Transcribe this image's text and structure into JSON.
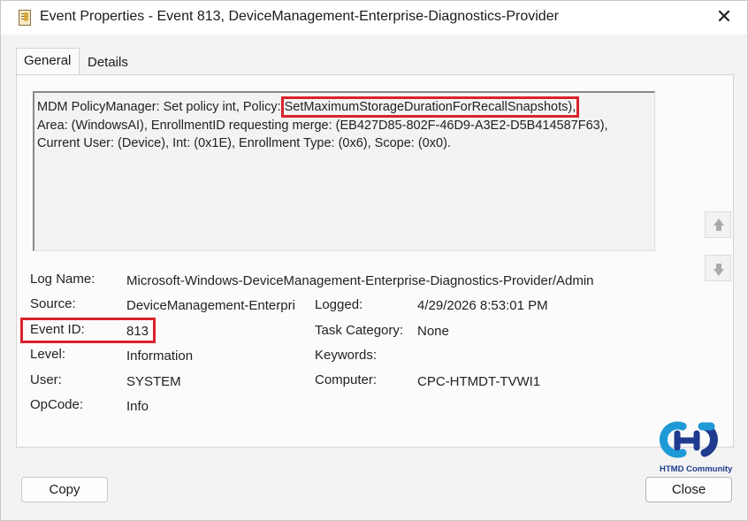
{
  "window": {
    "title": "Event Properties - Event 813, DeviceManagement-Enterprise-Diagnostics-Provider",
    "close_glyph": "✕"
  },
  "tabs": [
    {
      "label": "General",
      "active": true
    },
    {
      "label": "Details",
      "active": false
    }
  ],
  "description": {
    "prefix": "MDM PolicyManager: Set policy int, Policy: ",
    "policy": "SetMaximumStorageDurationForRecallSnapshots),",
    "line2": "Area: (WindowsAI), EnrollmentID requesting merge: (EB427D85-802F-46D9-A3E2-D5B414587F63),",
    "line3": "Current User: (Device), Int: (0x1E), Enrollment Type: (0x6), Scope: (0x0)."
  },
  "fields": {
    "log_name_label": "Log Name:",
    "log_name": "Microsoft-Windows-DeviceManagement-Enterprise-Diagnostics-Provider/Admin",
    "source_label": "Source:",
    "source": "DeviceManagement-Enterpri",
    "logged_label": "Logged:",
    "logged": "4/29/2026 8:53:01 PM",
    "event_id_label": "Event ID:",
    "event_id": "813",
    "task_category_label": "Task Category:",
    "task_category": "None",
    "level_label": "Level:",
    "level": "Information",
    "keywords_label": "Keywords:",
    "keywords": "",
    "user_label": "User:",
    "user": "SYSTEM",
    "computer_label": "Computer:",
    "computer": "CPC-HTMDT-TVWI1",
    "opcode_label": "OpCode:",
    "opcode": "Info"
  },
  "buttons": {
    "copy": "Copy",
    "close": "Close"
  },
  "watermark": {
    "text": "HTMD Community"
  },
  "colors": {
    "highlight": "#d9232e",
    "logo_blue": "#1f3b8e",
    "logo_light": "#1e9ad6"
  },
  "icons": {
    "app": "event-log-icon",
    "scroll_up": "arrow-up-icon",
    "scroll_down": "arrow-down-icon"
  }
}
